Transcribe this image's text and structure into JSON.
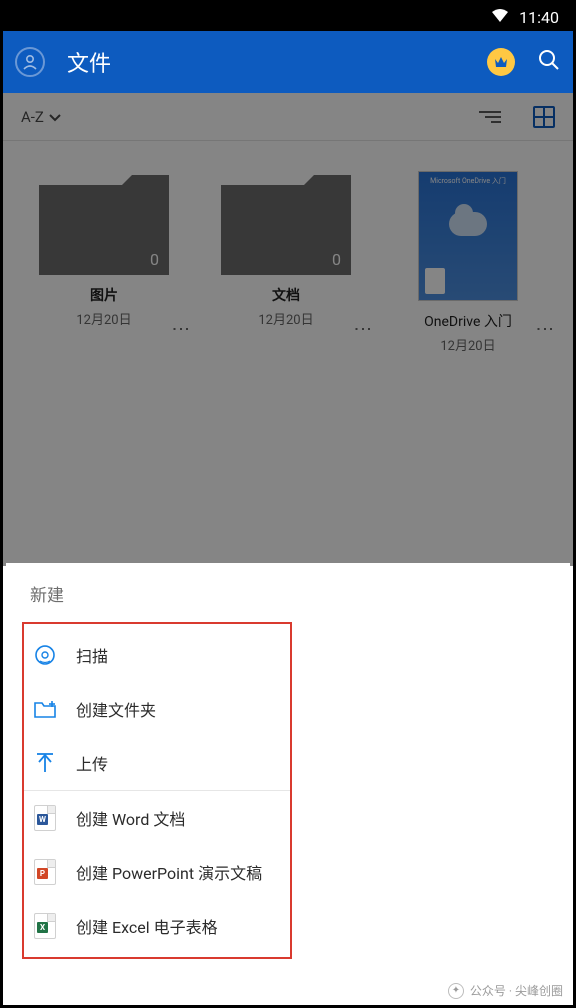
{
  "status": {
    "time": "11:40"
  },
  "header": {
    "title": "文件"
  },
  "toolbar": {
    "sort_label": "A-Z"
  },
  "files": [
    {
      "name": "图片",
      "date": "12月20日",
      "count": "0",
      "type": "folder"
    },
    {
      "name": "文档",
      "date": "12月20日",
      "count": "0",
      "type": "folder"
    },
    {
      "name": "OneDrive 入门",
      "date": "12月20日",
      "type": "doc",
      "card_text": "Microsoft OneDrive 入门"
    }
  ],
  "sheet": {
    "title": "新建",
    "items": [
      {
        "icon": "scan",
        "label": "扫描"
      },
      {
        "icon": "folder",
        "label": "创建文件夹"
      },
      {
        "icon": "upload",
        "label": "上传"
      }
    ],
    "doc_items": [
      {
        "app": "word",
        "label": "创建 Word 文档"
      },
      {
        "app": "ppt",
        "label": "创建 PowerPoint 演示文稿"
      },
      {
        "app": "xls",
        "label": "创建 Excel 电子表格"
      }
    ]
  },
  "watermark": {
    "text": "公众号 · 尖峰创圈"
  }
}
